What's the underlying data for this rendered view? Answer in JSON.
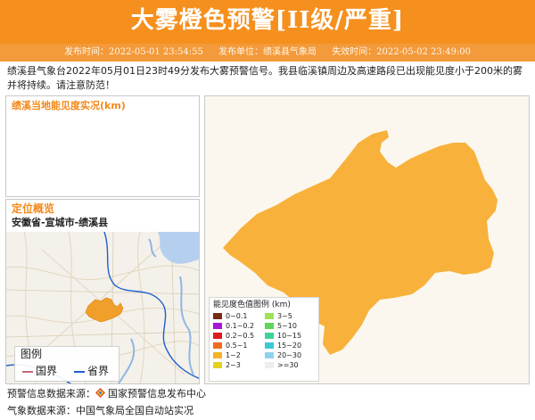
{
  "header": {
    "title": "大雾橙色预警[II级/严重]",
    "publish_time": "发布时间：2022-05-01 23:54:55",
    "publisher": "发布单位：绩溪县气象局",
    "expire_time": "失效时间：2022-05-02 23:49:00",
    "color": "#f5901e"
  },
  "description": "绩溪县气象台2022年05月01日23时49分发布大雾预警信号。我县临溪镇周边及高速路段已出现能见度小于200米的雾并将持续。请注意防范！",
  "visibility_panel": {
    "title": "绩溪当地能见度实况(km)"
  },
  "location_panel": {
    "title": "定位概览",
    "path": "安徽省-宣城市-绩溪县",
    "legend": {
      "title": "图例",
      "items": [
        {
          "label": "国界",
          "color": "#c0687a"
        },
        {
          "label": "省界",
          "color": "#1e5fd0"
        }
      ]
    }
  },
  "main_map": {
    "region_color": "#f8b13a",
    "legend": {
      "title": "能见度色值图例 (km)",
      "items": [
        {
          "label": "0~0.1",
          "color": "#7b2a14"
        },
        {
          "label": "3~5",
          "color": "#9ee25a"
        },
        {
          "label": "0.1~0.2",
          "color": "#a516d8"
        },
        {
          "label": "5~10",
          "color": "#5fd65a"
        },
        {
          "label": "0.2~0.5",
          "color": "#e01b1b"
        },
        {
          "label": "10~15",
          "color": "#3fd19a"
        },
        {
          "label": "0.5~1",
          "color": "#f26b1d"
        },
        {
          "label": "15~20",
          "color": "#3fc7d8"
        },
        {
          "label": "1~2",
          "color": "#f5b226"
        },
        {
          "label": "20~30",
          "color": "#8fd2ee"
        },
        {
          "label": "2~3",
          "color": "#e2d21e"
        },
        {
          "label": ">=30",
          "color": "#ededed"
        }
      ]
    }
  },
  "sources": {
    "warning_prefix": "预警信息数据来源：",
    "warning_source": "国家预警信息发布中心",
    "weather": "气象数据来源：中国气象局全国自动站实况"
  }
}
